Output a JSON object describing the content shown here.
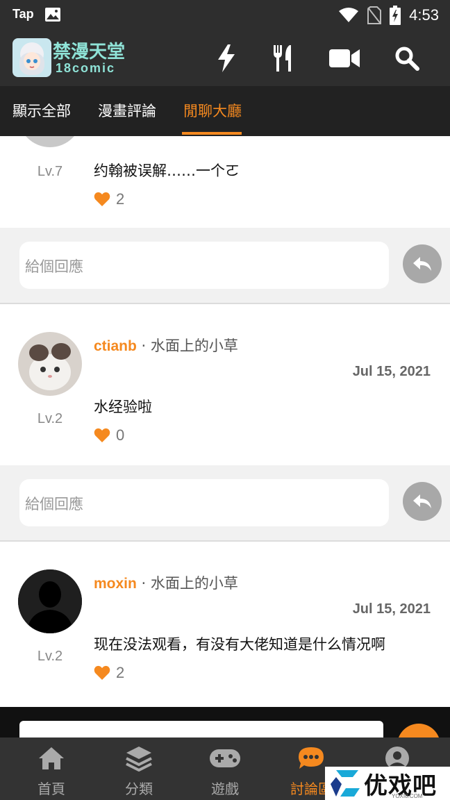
{
  "status_bar": {
    "carrier": "Tap",
    "time": "4:53"
  },
  "header": {
    "logo_text": "禁漫天堂",
    "logo_subtext": "18comic",
    "icons": [
      "lightning-icon",
      "utensils-icon",
      "video-icon",
      "search-icon"
    ]
  },
  "tabs": [
    {
      "label": "顯示全部",
      "active": false
    },
    {
      "label": "漫畫評論",
      "active": false
    },
    {
      "label": "閒聊大廳",
      "active": true
    }
  ],
  "comments": [
    {
      "author": "",
      "topic": "",
      "date": "",
      "level": "Lv.7",
      "text": "约翰被误解……一个ㄛ",
      "likes": "2"
    },
    {
      "author": "ctianb",
      "topic": "· 水面上的小草",
      "date": "Jul 15, 2021",
      "level": "Lv.2",
      "text": "水经验啦",
      "likes": "0"
    },
    {
      "author": "moxin",
      "topic": "· 水面上的小草",
      "date": "Jul 15, 2021",
      "level": "Lv.2",
      "text": "现在没法观看，有没有大佬知道是什么情况啊",
      "likes": "2"
    }
  ],
  "reply_placeholder": "給個回應",
  "bottom_nav": [
    {
      "label": "首頁",
      "icon": "home-icon",
      "active": false
    },
    {
      "label": "分類",
      "icon": "layers-icon",
      "active": false
    },
    {
      "label": "遊戲",
      "icon": "gamepad-icon",
      "active": false
    },
    {
      "label": "討論區",
      "icon": "chat-icon",
      "active": true
    },
    {
      "label": "",
      "icon": "profile-icon",
      "active": false
    }
  ],
  "watermark": {
    "text": "优戏吧",
    "sub": "YOXI8.COM"
  },
  "colors": {
    "accent": "#f5891f",
    "header_bg": "#2e2e2e",
    "tab_bg": "#222222",
    "nav_bg": "#333333"
  }
}
